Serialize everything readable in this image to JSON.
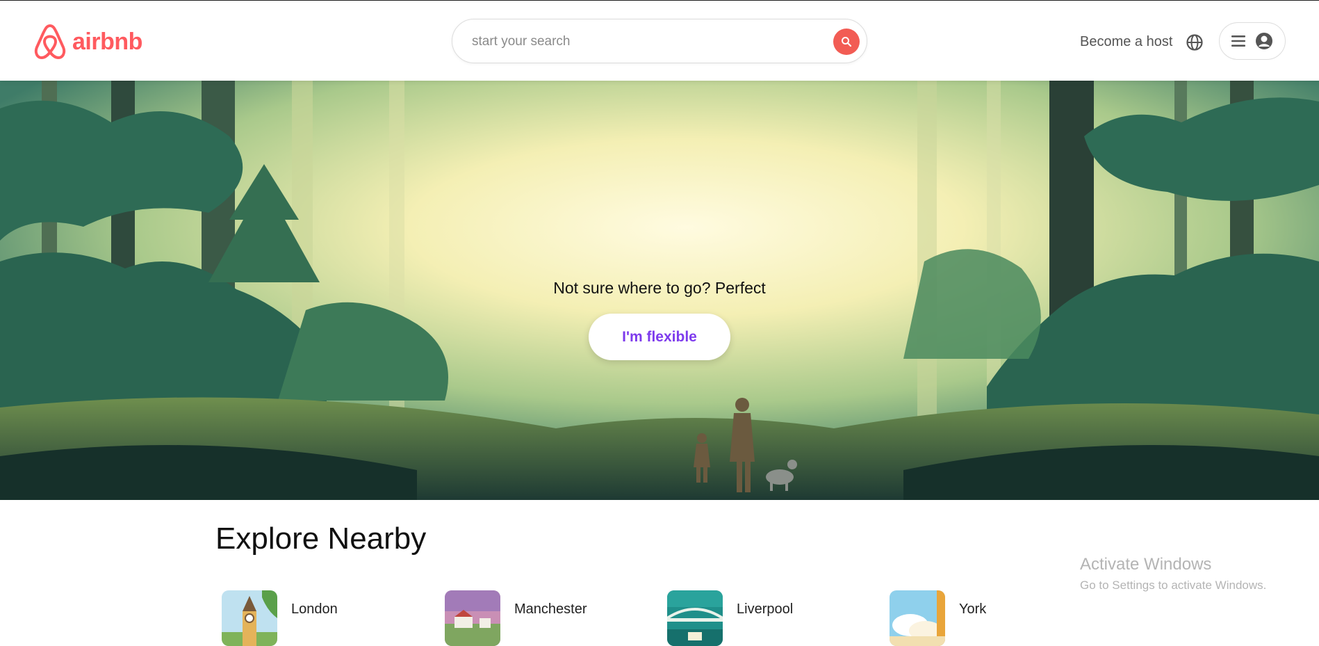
{
  "header": {
    "brand": "airbnb",
    "brand_color": "#ff5a5f",
    "search_placeholder": "start your search",
    "search_icon": "search-icon",
    "host_label": "Become a host",
    "globe_icon": "globe-icon",
    "menu_icon": "hamburger-icon",
    "avatar_icon": "user-circle-icon"
  },
  "hero": {
    "tagline": "Not sure where to go? Perfect",
    "button_label": "I'm flexible",
    "button_color": "#7e3bed"
  },
  "explore": {
    "title": "Explore Nearby",
    "cities": [
      {
        "name": "London"
      },
      {
        "name": "Manchester"
      },
      {
        "name": "Liverpool"
      },
      {
        "name": "York"
      }
    ]
  },
  "overlay": {
    "activate_title": "Activate Windows",
    "activate_sub": "Go to Settings to activate Windows."
  }
}
